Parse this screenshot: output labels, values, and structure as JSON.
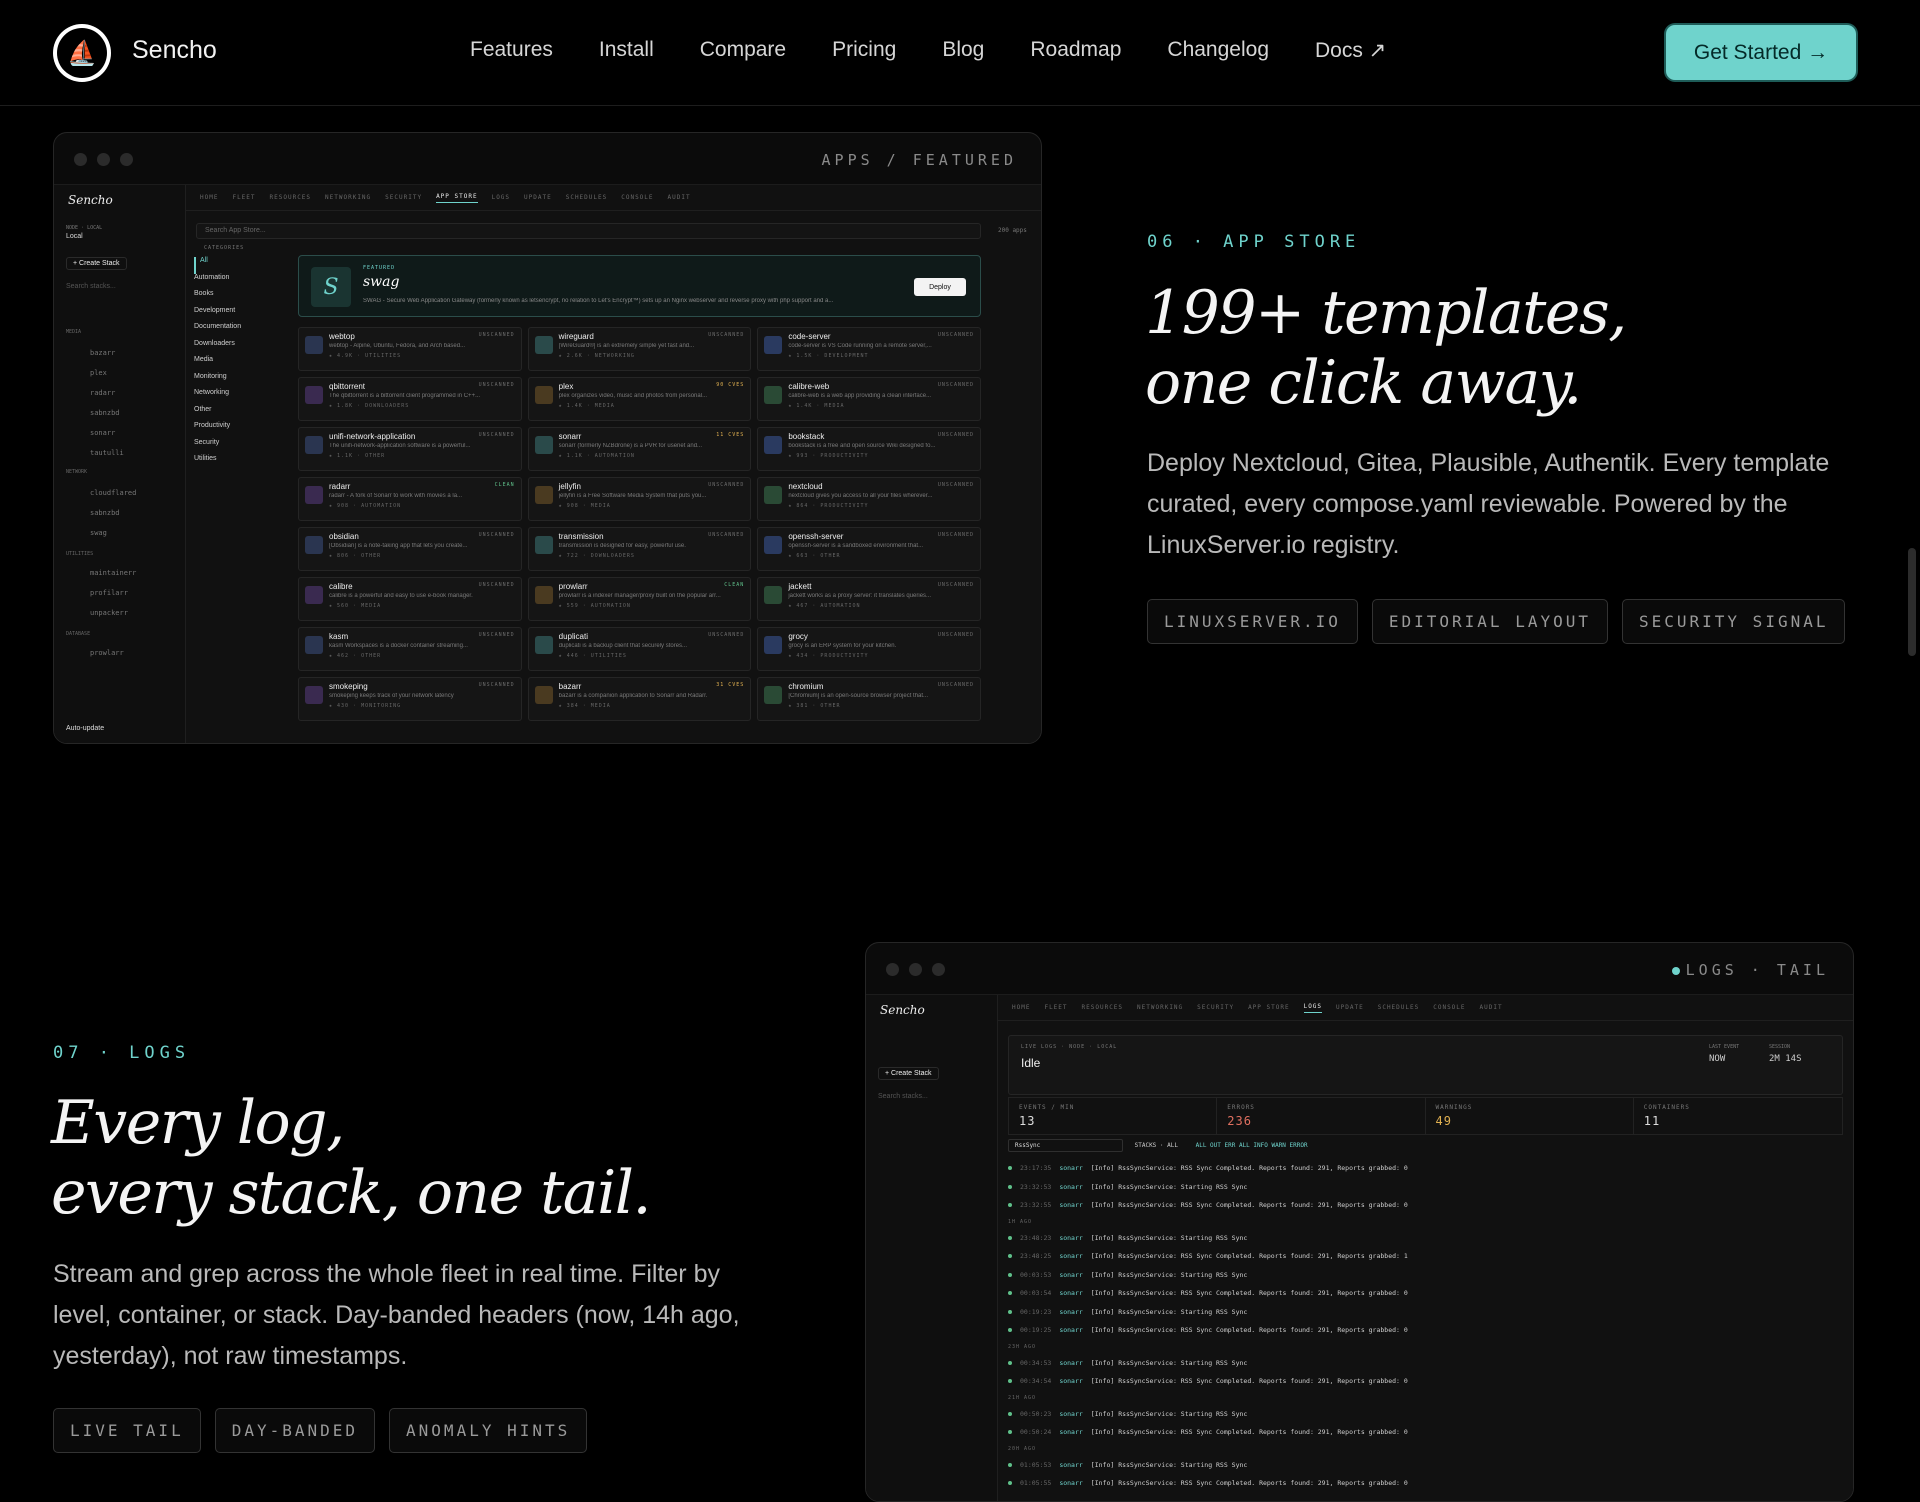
{
  "nav": {
    "brand": "Sencho",
    "links": [
      "Features",
      "Install",
      "Compare",
      "Pricing",
      "Blog",
      "Roadmap",
      "Changelog",
      "Docs ↗"
    ],
    "cta": "Get Started →"
  },
  "section06": {
    "eyebrow": "06 · APP STORE",
    "headline_l1": "199+ templates,",
    "headline_l2": "one click away.",
    "body": "Deploy Nextcloud, Gitea, Plausible, Authentik. Every template curated, every compose.yaml reviewable. Powered by the LinuxServer.io registry.",
    "chips": [
      "LINUXSERVER.IO",
      "EDITORIAL LAYOUT",
      "SECURITY SIGNAL"
    ],
    "mockup": {
      "crumb": "APPS / FEATURED",
      "brand": "Sencho",
      "tabs": [
        "HOME",
        "FLEET",
        "RESOURCES",
        "NETWORKING",
        "SECURITY",
        "APP STORE",
        "LOGS",
        "UPDATE",
        "SCHEDULES",
        "CONSOLE",
        "AUDIT"
      ],
      "active_tab": "APP STORE",
      "node_label": "NODE · LOCAL",
      "node_value": "Local",
      "create_stack": "+ Create Stack",
      "search_stacks": "Search stacks...",
      "search": "Search App Store...",
      "app_count": "200 apps",
      "categories_title": "CATEGORIES",
      "categories": [
        "All",
        "Automation",
        "Books",
        "Development",
        "Documentation",
        "Downloaders",
        "Media",
        "Monitoring",
        "Networking",
        "Other",
        "Productivity",
        "Security",
        "Utilities"
      ],
      "featured_tag": "FEATURED",
      "featured_name": "swag",
      "featured_letter": "S",
      "featured_desc": "SWAG - Secure Web Application Gateway (formerly known as letsencrypt, no relation to Let's Encrypt™) sets up an Nginx webserver and reverse proxy with php support and a...",
      "deploy": "Deploy",
      "apps": [
        {
          "name": "webtop",
          "desc": "webtop - Alpine, Ubuntu, Fedora, and Arch based...",
          "meta": "4.9K · UTILITIES",
          "tag": "UNSCANNED"
        },
        {
          "name": "wireguard",
          "desc": "[WireGuard®] is an extremely simple yet fast and...",
          "meta": "2.6K · NETWORKING",
          "tag": "UNSCANNED"
        },
        {
          "name": "code-server",
          "desc": "code-server is VS Code running on a remote server,...",
          "meta": "1.5K · DEVELOPMENT",
          "tag": "UNSCANNED"
        },
        {
          "name": "qbittorrent",
          "desc": "The qbittorrent is a bittorrent client programmed in C++...",
          "meta": "1.8K · DOWNLOADERS",
          "tag": "UNSCANNED"
        },
        {
          "name": "plex",
          "desc": "plex organizes video, music and photos from personal...",
          "meta": "1.4K · MEDIA",
          "tag": "90 CVES"
        },
        {
          "name": "calibre-web",
          "desc": "calibre-web is a web app providing a clean interface...",
          "meta": "1.4K · MEDIA",
          "tag": "UNSCANNED"
        },
        {
          "name": "unifi-network-application",
          "desc": "The unifi-network-application software is a powerful...",
          "meta": "1.1K · OTHER",
          "tag": "UNSCANNED"
        },
        {
          "name": "sonarr",
          "desc": "sonarr (formerly NZBdrone) is a PVR for usenet and...",
          "meta": "1.1K · AUTOMATION",
          "tag": "11 CVES"
        },
        {
          "name": "bookstack",
          "desc": "bookstack is a free and open source Wiki designed fo...",
          "meta": "993 · PRODUCTIVITY",
          "tag": "UNSCANNED"
        },
        {
          "name": "radarr",
          "desc": "radarr - A fork of Sonarr to work with movies à la...",
          "meta": "908 · AUTOMATION",
          "tag": "CLEAN"
        },
        {
          "name": "jellyfin",
          "desc": "jellyfin is a Free Software Media System that puts you...",
          "meta": "908 · MEDIA",
          "tag": "UNSCANNED"
        },
        {
          "name": "nextcloud",
          "desc": "nextcloud gives you access to all your files wherever...",
          "meta": "864 · PRODUCTIVITY",
          "tag": "UNSCANNED"
        },
        {
          "name": "obsidian",
          "desc": "[Obsidian] is a note-taking app that lets you create...",
          "meta": "806 · OTHER",
          "tag": "UNSCANNED"
        },
        {
          "name": "transmission",
          "desc": "transmission is designed for easy, powerful use.",
          "meta": "722 · DOWNLOADERS",
          "tag": "UNSCANNED"
        },
        {
          "name": "openssh-server",
          "desc": "openssh-server is a sandboxed environment that...",
          "meta": "663 · OTHER",
          "tag": "UNSCANNED"
        },
        {
          "name": "calibre",
          "desc": "calibre is a powerful and easy to use e-book manager.",
          "meta": "560 · MEDIA",
          "tag": "UNSCANNED"
        },
        {
          "name": "prowlarr",
          "desc": "prowlarr is a indexer manager/proxy built on the popular arr...",
          "meta": "559 · AUTOMATION",
          "tag": "CLEAN"
        },
        {
          "name": "jackett",
          "desc": "jackett works as a proxy server: it translates queries...",
          "meta": "467 · AUTOMATION",
          "tag": "UNSCANNED"
        },
        {
          "name": "kasm",
          "desc": "kasm Workspaces is a docker container streaming...",
          "meta": "462 · OTHER",
          "tag": "UNSCANNED"
        },
        {
          "name": "duplicati",
          "desc": "duplicati is a backup client that securely stores...",
          "meta": "446 · UTILITIES",
          "tag": "UNSCANNED"
        },
        {
          "name": "grocy",
          "desc": "grocy is an ERP system for your kitchen.",
          "meta": "434 · PRODUCTIVITY",
          "tag": "UNSCANNED"
        },
        {
          "name": "smokeping",
          "desc": "smokeping keeps track of your network latency",
          "meta": "430 · MONITORING",
          "tag": "UNSCANNED"
        },
        {
          "name": "bazarr",
          "desc": "bazarr is a companion application to Sonarr and Radarr.",
          "meta": "384 · MEDIA",
          "tag": "31 CVES"
        },
        {
          "name": "chromium",
          "desc": "[Chromium] is an open-source browser project that...",
          "meta": "381 · OTHER",
          "tag": "UNSCANNED"
        }
      ],
      "stacks": {
        "media_title": "MEDIA",
        "media": [
          "bazarr",
          "plex",
          "radarr",
          "sabnzbd",
          "sonarr",
          "tautulli"
        ],
        "network_title": "NETWORK",
        "network": [
          "cloudflared",
          "sabnzbd",
          "swag"
        ],
        "utilities_title": "UTILITIES",
        "utilities": [
          "maintainerr",
          "profilarr",
          "unpackerr"
        ],
        "database_title": "DATABASE",
        "database": [
          "prowlarr"
        ]
      },
      "autoupdate": "Auto-update"
    }
  },
  "section07": {
    "eyebrow": "07 · LOGS",
    "headline_l1": "Every log,",
    "headline_l2": "every stack, one tail.",
    "body": "Stream and grep across the whole fleet in real time. Filter by level, container, or stack. Day-banded headers (now, 14h ago, yesterday), not raw timestamps.",
    "chips": [
      "LIVE TAIL",
      "DAY-BANDED",
      "ANOMALY HINTS"
    ],
    "mockup": {
      "crumb": "LOGS · TAIL",
      "brand": "Sencho",
      "active_tab": "LOGS",
      "tabs": [
        "HOME",
        "FLEET",
        "RESOURCES",
        "NETWORKING",
        "SECURITY",
        "APP STORE",
        "LOGS",
        "UPDATE",
        "SCHEDULES",
        "CONSOLE",
        "AUDIT"
      ],
      "live_label": "LIVE LOGS · NODE · LOCAL",
      "status": "Idle",
      "last_event_label": "LAST EVENT",
      "last_event": "NOW",
      "session_label": "SESSION",
      "session": "2M 14S",
      "stats": [
        {
          "label": "EVENTS / MIN",
          "value": "13"
        },
        {
          "label": "ERRORS",
          "value": "236"
        },
        {
          "label": "WARNINGS",
          "value": "49"
        },
        {
          "label": "CONTAINERS",
          "value": "11"
        }
      ],
      "filter_value": "RssSync",
      "filter_stacks": "STACKS · ALL",
      "filter_levels": "ALL  OUT  ERR   ALL  INFO  WARN  ERROR",
      "lines": [
        {
          "t": "23:17:35",
          "s": "sonarr",
          "m": "[Info] RssSyncService: RSS Sync Completed. Reports found: 291, Reports grabbed: 0"
        },
        {
          "t": "23:32:53",
          "s": "sonarr",
          "m": "[Info] RssSyncService: Starting RSS Sync"
        },
        {
          "t": "23:32:55",
          "s": "sonarr",
          "m": "[Info] RssSyncService: RSS Sync Completed. Reports found: 291, Reports grabbed: 0"
        },
        {
          "hdr": "1H AGO"
        },
        {
          "t": "23:48:23",
          "s": "sonarr",
          "m": "[Info] RssSyncService: Starting RSS Sync"
        },
        {
          "t": "23:48:25",
          "s": "sonarr",
          "m": "[Info] RssSyncService: RSS Sync Completed. Reports found: 291, Reports grabbed: 1"
        },
        {
          "t": "00:03:53",
          "s": "sonarr",
          "m": "[Info] RssSyncService: Starting RSS Sync"
        },
        {
          "t": "00:03:54",
          "s": "sonarr",
          "m": "[Info] RssSyncService: RSS Sync Completed. Reports found: 291, Reports grabbed: 0"
        },
        {
          "t": "00:19:23",
          "s": "sonarr",
          "m": "[Info] RssSyncService: Starting RSS Sync"
        },
        {
          "t": "00:19:25",
          "s": "sonarr",
          "m": "[Info] RssSyncService: RSS Sync Completed. Reports found: 291, Reports grabbed: 0"
        },
        {
          "hdr": "23H AGO"
        },
        {
          "t": "00:34:53",
          "s": "sonarr",
          "m": "[Info] RssSyncService: Starting RSS Sync"
        },
        {
          "t": "00:34:54",
          "s": "sonarr",
          "m": "[Info] RssSyncService: RSS Sync Completed. Reports found: 291, Reports grabbed: 0"
        },
        {
          "hdr": "21H AGO"
        },
        {
          "t": "00:50:23",
          "s": "sonarr",
          "m": "[Info] RssSyncService: Starting RSS Sync"
        },
        {
          "t": "00:50:24",
          "s": "sonarr",
          "m": "[Info] RssSyncService: RSS Sync Completed. Reports found: 291, Reports grabbed: 0"
        },
        {
          "hdr": "20H AGO"
        },
        {
          "t": "01:05:53",
          "s": "sonarr",
          "m": "[Info] RssSyncService: Starting RSS Sync"
        },
        {
          "t": "01:05:55",
          "s": "sonarr",
          "m": "[Info] RssSyncService: RSS Sync Completed. Reports found: 291, Reports grabbed: 0"
        }
      ]
    }
  },
  "colors": {
    "accent": "#6fd3cc",
    "bg": "#000000",
    "error": "#e07060",
    "warn": "#e0b050"
  }
}
